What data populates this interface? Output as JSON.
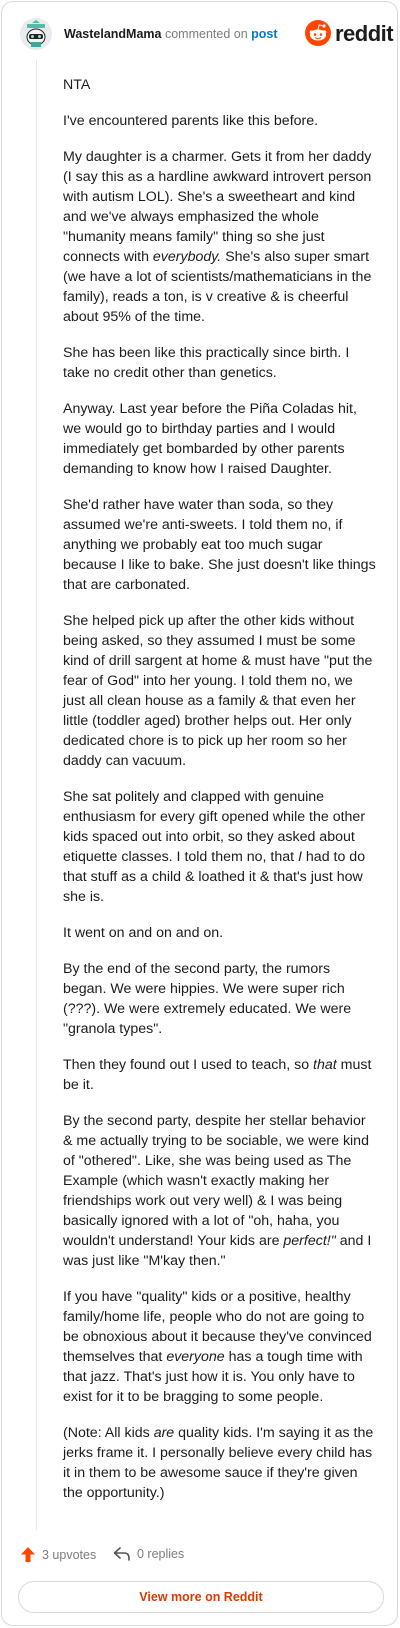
{
  "header": {
    "username": "WastelandMama",
    "verb": "commented on",
    "post_link": "post",
    "brand": "reddit",
    "avatar_icon": "snoo-avatar-icon",
    "logo_icon": "reddit-snoo-icon",
    "brand_color": "#ff4500"
  },
  "comment": {
    "paragraphs": [
      {
        "runs": [
          {
            "t": "NTA"
          }
        ]
      },
      {
        "runs": [
          {
            "t": "I've encountered parents like this before."
          }
        ]
      },
      {
        "runs": [
          {
            "t": "My daughter is a charmer. Gets it from her daddy (I say this as a hardline awkward introvert person with autism LOL). She's a sweetheart and kind and we've always emphasized the whole \"humanity means family\" thing so she just connects with "
          },
          {
            "t": "everybody.",
            "i": true
          },
          {
            "t": " She's also super smart (we have a lot of scientists/mathematicians in the family), reads a ton, is v creative & is cheerful about 95% of the time."
          }
        ]
      },
      {
        "runs": [
          {
            "t": "She has been like this practically since birth. I take no credit other than genetics."
          }
        ]
      },
      {
        "runs": [
          {
            "t": "Anyway. Last year before the Piña Coladas hit, we would go to birthday parties and I would immediately get bombarded by other parents demanding to know how I raised Daughter."
          }
        ]
      },
      {
        "runs": [
          {
            "t": "She'd rather have water than soda, so they assumed we're anti-sweets. I told them no, if anything we probably eat too much sugar because I like to bake. She just doesn't like things that are carbonated."
          }
        ]
      },
      {
        "runs": [
          {
            "t": "She helped pick up after the other kids without being asked, so they assumed I must be some kind of drill sargent at home & must have \"put the fear of God\" into her young. I told them no, we just all clean house as a family & that even her little (toddler aged) brother helps out. Her only dedicated chore is to pick up her room so her daddy can vacuum."
          }
        ]
      },
      {
        "runs": [
          {
            "t": "She sat politely and clapped with genuine enthusiasm for every gift opened while the other kids spaced out into orbit, so they asked about etiquette classes. I told them no, that "
          },
          {
            "t": "I",
            "i": true
          },
          {
            "t": " had to do that stuff as a child & loathed it & that's just how she is."
          }
        ]
      },
      {
        "runs": [
          {
            "t": "It went on and on and on."
          }
        ]
      },
      {
        "runs": [
          {
            "t": "By the end of the second party, the rumors began. We were hippies. We were super rich (???). We were extremely educated. We were \"granola types\"."
          }
        ]
      },
      {
        "runs": [
          {
            "t": "Then they found out I used to teach, so "
          },
          {
            "t": "that",
            "i": true
          },
          {
            "t": " must be it."
          }
        ]
      },
      {
        "runs": [
          {
            "t": "By the second party, despite her stellar behavior & me actually trying to be sociable, we were kind of \"othered\". Like, she was being used as The Example (which wasn't exactly making her friendships work out very well) & I was being basically ignored with a lot of \"oh, haha, you wouldn't understand! Your kids are "
          },
          {
            "t": "perfect!\"",
            "i": true
          },
          {
            "t": " and I was just like \"M'kay then.\""
          }
        ]
      },
      {
        "runs": [
          {
            "t": "If you have \"quality\" kids or a positive, healthy family/home life, people who do not are going to be obnoxious about it because they've convinced themselves that "
          },
          {
            "t": "everyone",
            "i": true
          },
          {
            "t": " has a tough time with that jazz. That's just how it is. You only have to exist for it to be bragging to some people."
          }
        ]
      },
      {
        "runs": [
          {
            "t": "(Note: All kids "
          },
          {
            "t": "are",
            "i": true
          },
          {
            "t": " quality kids. I'm saying it as the jerks frame it. I personally believe every child has it in them to be awesome sauce if they're given the opportunity.)"
          }
        ]
      }
    ]
  },
  "footer": {
    "upvotes": "3 upvotes",
    "replies": "0 replies",
    "upvote_icon": "upvote-arrow-icon",
    "reply_icon": "reply-arrow-icon",
    "upvote_color": "#ff4500"
  },
  "view_more_label": "View more on Reddit"
}
